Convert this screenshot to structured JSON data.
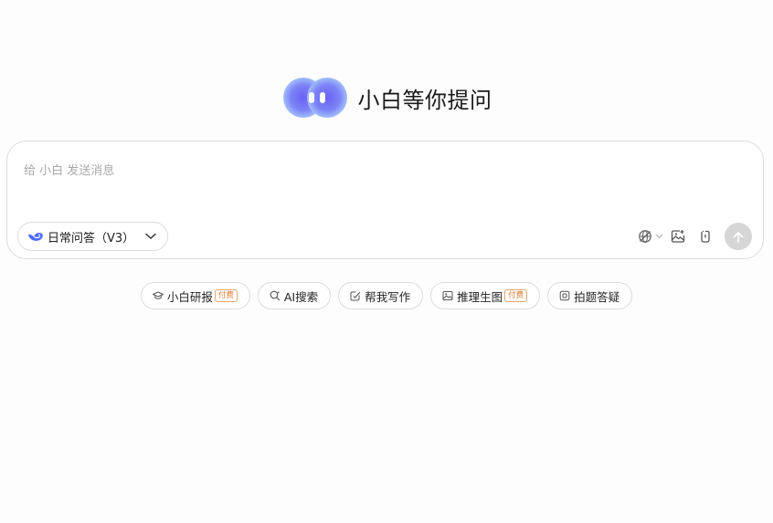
{
  "hero": {
    "title": "小白等你提问"
  },
  "composer": {
    "placeholder": "给 小白 发送消息",
    "value": "",
    "mode_label": "日常问答（V3）"
  },
  "chips": [
    {
      "label": "小白研报",
      "badge": "付费",
      "icon": "graduation-cap-icon"
    },
    {
      "label": "AI搜索",
      "badge": "",
      "icon": "search-sparkle-icon"
    },
    {
      "label": "帮我写作",
      "badge": "",
      "icon": "pen-check-icon"
    },
    {
      "label": "推理生图",
      "badge": "付费",
      "icon": "image-icon"
    },
    {
      "label": "拍题答疑",
      "badge": "",
      "icon": "photo-question-icon"
    }
  ],
  "colors": {
    "accent_blue": "#6a62f6",
    "badge_orange": "#e07b2e",
    "border": "#dcdcdc",
    "send_disabled": "#d6d6d6"
  }
}
